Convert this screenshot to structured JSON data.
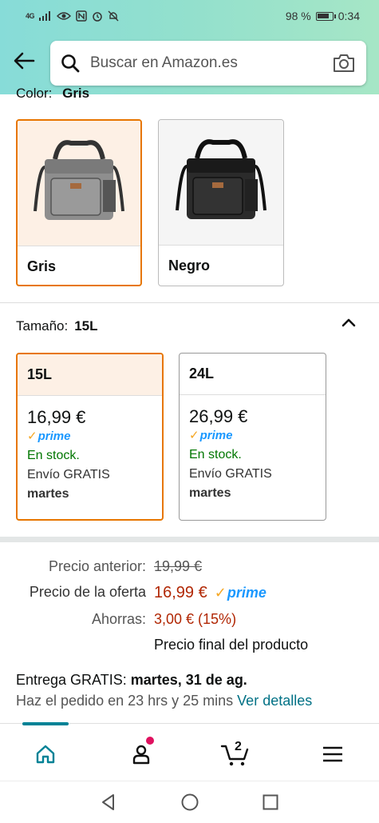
{
  "status_bar": {
    "network": "4G",
    "battery": "98 %",
    "time": "0:34"
  },
  "search": {
    "placeholder": "Buscar en Amazon.es"
  },
  "color_section": {
    "partial_label": "Color:",
    "partial_value": "Gris",
    "options": [
      {
        "label": "Gris",
        "selected": true
      },
      {
        "label": "Negro",
        "selected": false
      }
    ]
  },
  "size_section": {
    "label": "Tamaño:",
    "selected_value": "15L",
    "options": [
      {
        "label": "15L",
        "price": "16,99 €",
        "prime": "prime",
        "stock": "En stock.",
        "shipping": "Envío GRATIS",
        "day": "martes",
        "selected": true
      },
      {
        "label": "24L",
        "price": "26,99 €",
        "prime": "prime",
        "stock": "En stock.",
        "shipping": "Envío GRATIS",
        "day": "martes",
        "selected": false
      }
    ]
  },
  "pricing": {
    "previous_label": "Precio anterior:",
    "previous_value": "19,99 €",
    "deal_label": "Precio de la oferta",
    "deal_value": "16,99 €",
    "prime": "prime",
    "savings_label": "Ahorras:",
    "savings_value": "3,00 € (15%)",
    "final_note": "Precio final del producto"
  },
  "delivery": {
    "prefix": "Entrega GRATIS:",
    "date": "martes, 31 de ag.",
    "order_text": "Haz el pedido en 23 hrs y 25 mins",
    "details_link": "Ver detalles"
  },
  "bottom_nav": {
    "cart_count": "2",
    "items": [
      "home-icon",
      "account-icon",
      "cart-icon",
      "menu-icon"
    ]
  },
  "colors": {
    "accent_selected": "#e77600",
    "price_red": "#b12704",
    "stock_green": "#007600",
    "link_teal": "#007185",
    "prime_blue": "#1a98ff"
  }
}
